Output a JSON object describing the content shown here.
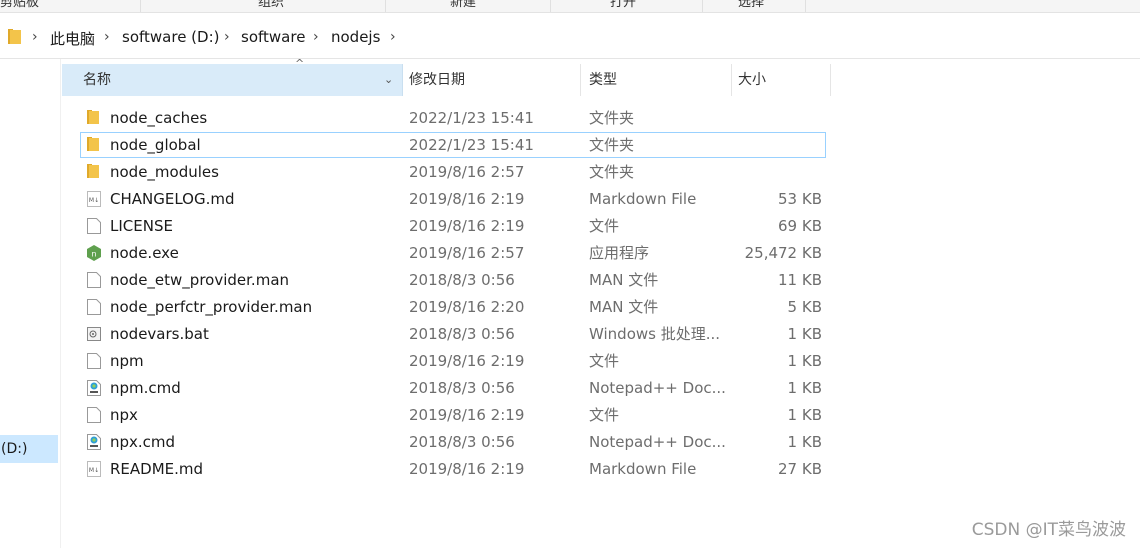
{
  "ribbon": {
    "labels": [
      "剪贴板",
      "组织",
      "新建",
      "打开",
      "选择"
    ]
  },
  "address": {
    "crumbs": [
      "此电脑",
      "software (D:)",
      "software",
      "nodejs"
    ]
  },
  "nav": {
    "drive_label": "(D:)"
  },
  "columns": {
    "name": "名称",
    "date": "修改日期",
    "type": "类型",
    "size": "大小"
  },
  "files": [
    {
      "name": "node_caches",
      "date": "2022/1/23 15:41",
      "type": "文件夹",
      "size": "",
      "icon": "folder-icon"
    },
    {
      "name": "node_global",
      "date": "2022/1/23 15:41",
      "type": "文件夹",
      "size": "",
      "icon": "folder-icon"
    },
    {
      "name": "node_modules",
      "date": "2019/8/16 2:57",
      "type": "文件夹",
      "size": "",
      "icon": "folder-icon"
    },
    {
      "name": "CHANGELOG.md",
      "date": "2019/8/16 2:19",
      "type": "Markdown File",
      "size": "53 KB",
      "icon": "markdown-file-icon"
    },
    {
      "name": "LICENSE",
      "date": "2019/8/16 2:19",
      "type": "文件",
      "size": "69 KB",
      "icon": "file-icon"
    },
    {
      "name": "node.exe",
      "date": "2019/8/16 2:57",
      "type": "应用程序",
      "size": "25,472 KB",
      "icon": "nodejs-icon"
    },
    {
      "name": "node_etw_provider.man",
      "date": "2018/8/3 0:56",
      "type": "MAN 文件",
      "size": "11 KB",
      "icon": "file-icon"
    },
    {
      "name": "node_perfctr_provider.man",
      "date": "2019/8/16 2:20",
      "type": "MAN 文件",
      "size": "5 KB",
      "icon": "file-icon"
    },
    {
      "name": "nodevars.bat",
      "date": "2018/8/3 0:56",
      "type": "Windows 批处理...",
      "size": "1 KB",
      "icon": "batch-file-icon"
    },
    {
      "name": "npm",
      "date": "2019/8/16 2:19",
      "type": "文件",
      "size": "1 KB",
      "icon": "file-icon"
    },
    {
      "name": "npm.cmd",
      "date": "2018/8/3 0:56",
      "type": "Notepad++ Doc...",
      "size": "1 KB",
      "icon": "notepadpp-file-icon"
    },
    {
      "name": "npx",
      "date": "2019/8/16 2:19",
      "type": "文件",
      "size": "1 KB",
      "icon": "file-icon"
    },
    {
      "name": "npx.cmd",
      "date": "2018/8/3 0:56",
      "type": "Notepad++ Doc...",
      "size": "1 KB",
      "icon": "notepadpp-file-icon"
    },
    {
      "name": "README.md",
      "date": "2019/8/16 2:19",
      "type": "Markdown File",
      "size": "27 KB",
      "icon": "markdown-file-icon"
    }
  ],
  "watermark": "CSDN @IT菜鸟波波",
  "colors": {
    "header_selected": "#d9ebf9",
    "row_focus": "#99d1ff",
    "nav_selected": "#cce8ff",
    "folder": "#f3c44a"
  }
}
